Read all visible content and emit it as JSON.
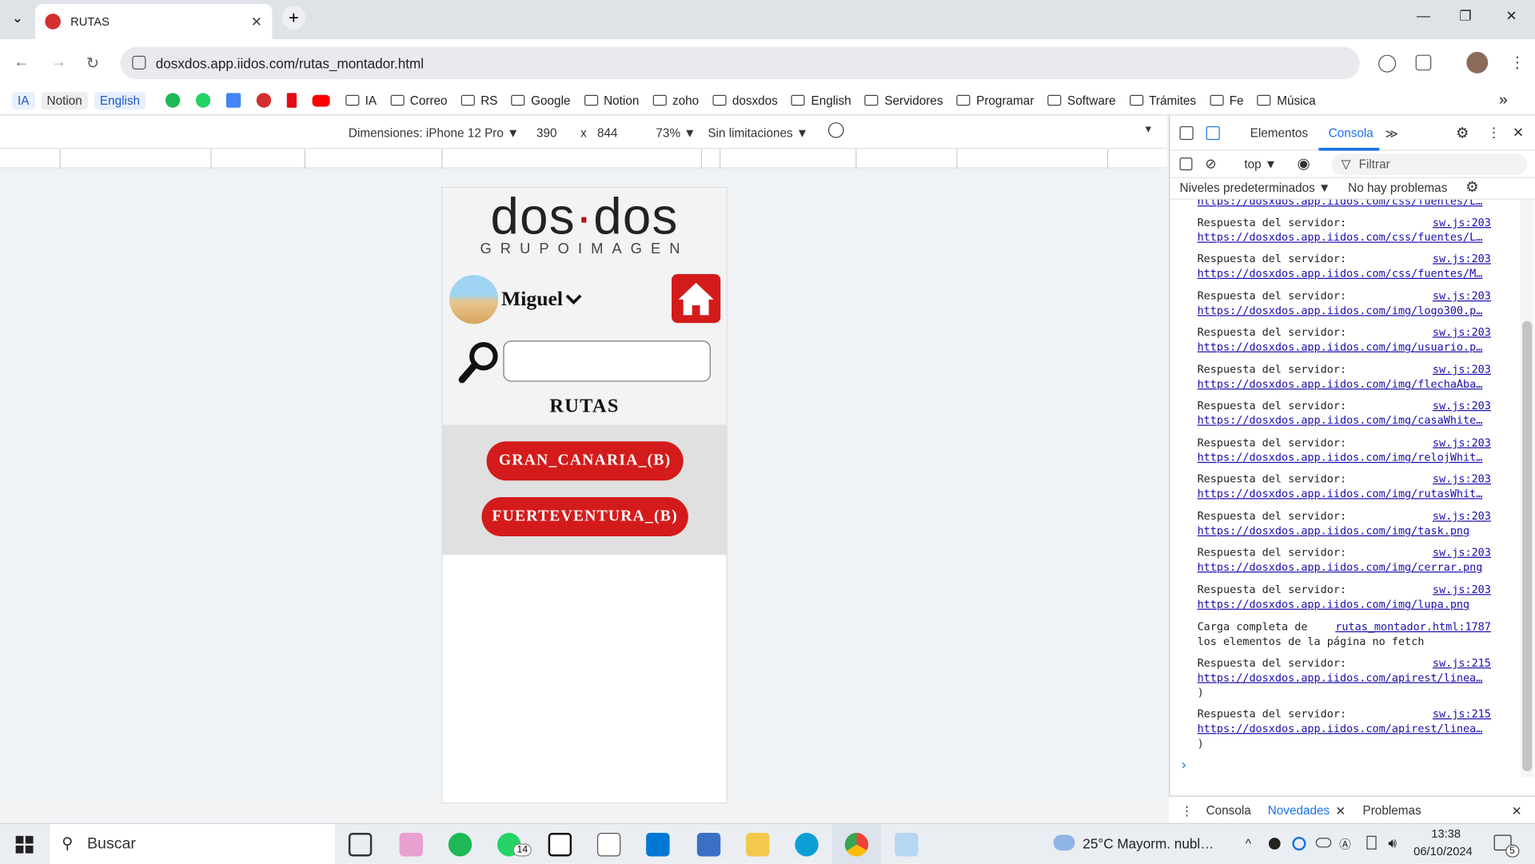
{
  "browser": {
    "tab_title": "RUTAS",
    "tab_close": "✕",
    "new_tab": "+",
    "url": "dosxdos.app.iidos.com/rutas_montador.html",
    "win_minimize": "—",
    "win_restore": "❐",
    "win_close": "✕",
    "tab_menu": "⌄"
  },
  "bookmarks": {
    "pills": [
      "IA",
      "Notion",
      "English"
    ],
    "folders": [
      "IA",
      "Correo",
      "RS",
      "Google",
      "Notion",
      "zoho",
      "dosxdos",
      "English",
      "Servidores",
      "Programar",
      "Software",
      "Trámites",
      "Fe",
      "Música"
    ],
    "more": "»"
  },
  "device_toolbar": {
    "dimensions_label": "Dimensiones: iPhone 12 Pro ▼",
    "width": "390",
    "times": "x",
    "height": "844",
    "zoom": "73% ▼",
    "throttle": "Sin limitaciones ▼"
  },
  "app": {
    "logo_main_left": "dos",
    "logo_dot": "·",
    "logo_main_right": "dos",
    "logo_sub": "GRUPOIMAGEN",
    "username": "Miguel",
    "page_title": "RUTAS",
    "routes": [
      "GRAN_CANARIA_(B)",
      "FUERTEVENTURA_(B)"
    ]
  },
  "devtools": {
    "tab_elements": "Elementos",
    "tab_console": "Consola",
    "tab_more": "≫",
    "context": "top ▼",
    "filter_placeholder": "Filtrar",
    "levels": "Niveles predeterminados ▼",
    "issues": "No hay problemas",
    "log_top_url": "https://dosxdos.app.iidos.com/css/fuentes/L…",
    "logs": [
      {
        "msg": "Respuesta del servidor:",
        "src": "sw.js:203",
        "url": "https://dosxdos.app.iidos.com/css/fuentes/L…"
      },
      {
        "msg": "Respuesta del servidor:",
        "src": "sw.js:203",
        "url": "https://dosxdos.app.iidos.com/css/fuentes/M…"
      },
      {
        "msg": "Respuesta del servidor:",
        "src": "sw.js:203",
        "url": "https://dosxdos.app.iidos.com/img/logo300.p…"
      },
      {
        "msg": "Respuesta del servidor:",
        "src": "sw.js:203",
        "url": "https://dosxdos.app.iidos.com/img/usuario.p…"
      },
      {
        "msg": "Respuesta del servidor:",
        "src": "sw.js:203",
        "url": "https://dosxdos.app.iidos.com/img/flechaAba…"
      },
      {
        "msg": "Respuesta del servidor:",
        "src": "sw.js:203",
        "url": "https://dosxdos.app.iidos.com/img/casaWhite…"
      },
      {
        "msg": "Respuesta del servidor:",
        "src": "sw.js:203",
        "url": "https://dosxdos.app.iidos.com/img/relojWhit…"
      },
      {
        "msg": "Respuesta del servidor:",
        "src": "sw.js:203",
        "url": "https://dosxdos.app.iidos.com/img/rutasWhit…"
      },
      {
        "msg": "Respuesta del servidor:",
        "src": "sw.js:203",
        "url": "https://dosxdos.app.iidos.com/img/task.png"
      },
      {
        "msg": "Respuesta del servidor:",
        "src": "sw.js:203",
        "url": "https://dosxdos.app.iidos.com/img/cerrar.png"
      },
      {
        "msg": "Respuesta del servidor:",
        "src": "sw.js:203",
        "url": "https://dosxdos.app.iidos.com/img/lupa.png"
      }
    ],
    "load_msg_1": "Carga completa de",
    "load_src": "rutas_montador.html:1787",
    "load_msg_2": "los elementos de la página no fetch",
    "api_logs": [
      {
        "msg": "Respuesta del servidor:",
        "src": "sw.js:215",
        "url": "https://dosxdos.app.iidos.com/apirest/linea…",
        "close": ")"
      },
      {
        "msg": "Respuesta del servidor:",
        "src": "sw.js:215",
        "url": "https://dosxdos.app.iidos.com/apirest/linea…",
        "close": ")"
      }
    ],
    "prompt": "›",
    "drawer_console": "Consola",
    "drawer_news": "Novedades",
    "drawer_issues": "Problemas"
  },
  "taskbar": {
    "search": "Buscar",
    "whatsapp_badge": "14",
    "weather": "25°C  Mayorm. nubl…",
    "time": "13:38",
    "date": "06/10/2024",
    "notif": "5"
  }
}
